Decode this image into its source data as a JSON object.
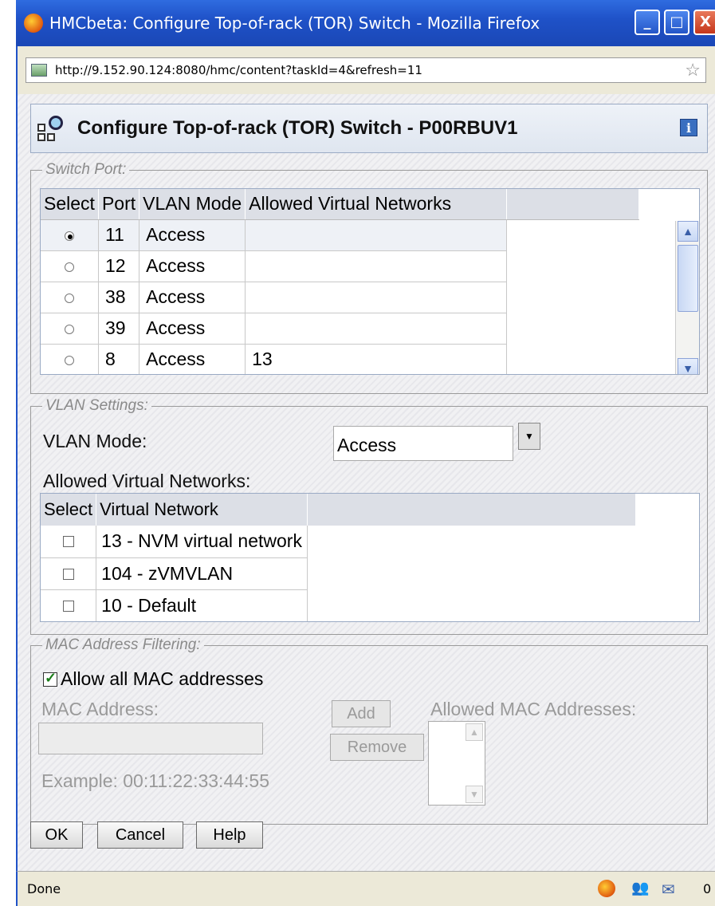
{
  "window": {
    "title": "HMCbeta: Configure Top-of-rack (TOR) Switch - Mozilla Firefox",
    "minimize_glyph": "_",
    "maximize_glyph": "□",
    "close_glyph": "X"
  },
  "url_bar": {
    "url": "http://9.152.90.124:8080/hmc/content?taskId=4&refresh=11"
  },
  "page": {
    "title": "Configure Top-of-rack (TOR) Switch - P00RBUV1",
    "info_glyph": "i"
  },
  "switch_port": {
    "legend": "Switch Port:",
    "columns": [
      "Select",
      "Port",
      "VLAN Mode",
      "Allowed Virtual Networks"
    ],
    "rows": [
      {
        "selected": true,
        "port": "11",
        "mode": "Access",
        "networks": ""
      },
      {
        "selected": false,
        "port": "12",
        "mode": "Access",
        "networks": ""
      },
      {
        "selected": false,
        "port": "38",
        "mode": "Access",
        "networks": ""
      },
      {
        "selected": false,
        "port": "39",
        "mode": "Access",
        "networks": ""
      },
      {
        "selected": false,
        "port": "8",
        "mode": "Access",
        "networks": "13"
      }
    ]
  },
  "vlan_settings": {
    "legend": "VLAN Settings:",
    "mode_label": "VLAN Mode:",
    "mode_value": "Access",
    "networks_label": "Allowed Virtual Networks:",
    "columns": [
      "Select",
      "Virtual Network"
    ],
    "networks": [
      {
        "checked": false,
        "name": "13 - NVM virtual network"
      },
      {
        "checked": false,
        "name": "104 - zVMVLAN"
      },
      {
        "checked": false,
        "name": "10 - Default"
      }
    ]
  },
  "mac_filtering": {
    "legend": "MAC Address Filtering:",
    "allow_all_label": "Allow all MAC addresses",
    "allow_all_checked": true,
    "mac_label": "MAC Address:",
    "allowed_label": "Allowed MAC Addresses:",
    "add_label": "Add",
    "remove_label": "Remove",
    "example": "Example: 00:11:22:33:44:55"
  },
  "buttons": {
    "ok": "OK",
    "cancel": "Cancel",
    "help": "Help"
  },
  "status_bar": {
    "text": "Done",
    "mail_count": "0"
  }
}
